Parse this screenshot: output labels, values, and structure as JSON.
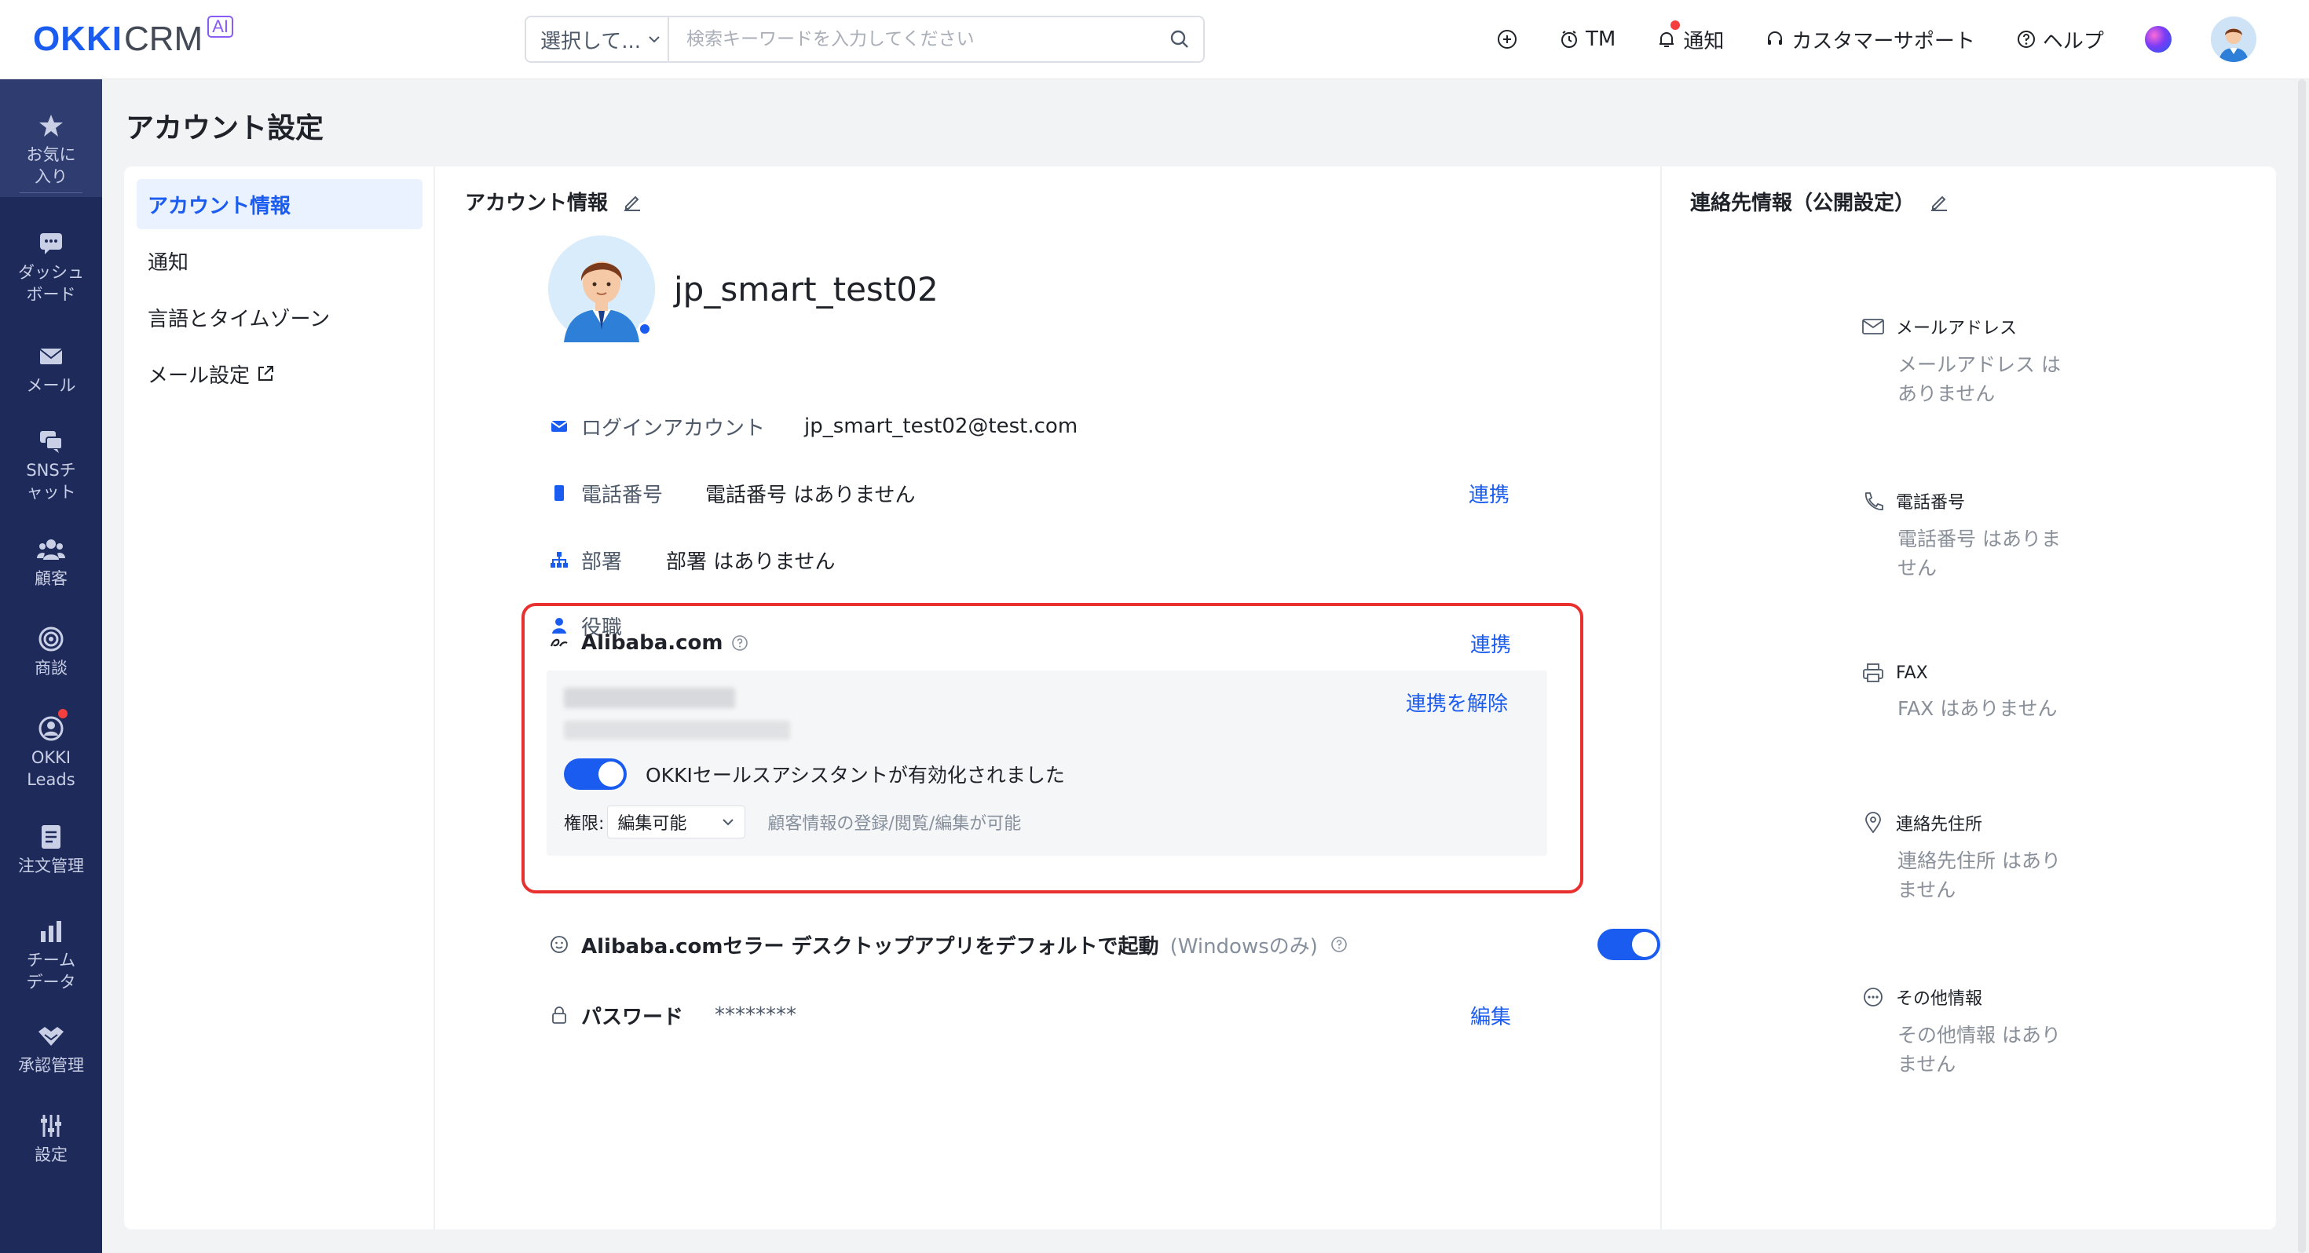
{
  "brand": {
    "okki": "OKKI",
    "crm": "CRM",
    "ai": "AI"
  },
  "search": {
    "select_label": "選択して...",
    "placeholder": "検索キーワードを入力してください"
  },
  "header": {
    "tm": "TM",
    "notify": "通知",
    "support": "カスタマーサポート",
    "help": "ヘルプ"
  },
  "sidebar": {
    "items": [
      {
        "label": "お気に入り",
        "icon": "star-icon"
      },
      {
        "label": "ダッシュボード",
        "icon": "chat-bubble-icon"
      },
      {
        "label": "メール",
        "icon": "envelope-icon"
      },
      {
        "label": "SNSチャット",
        "icon": "sns-chat-icon"
      },
      {
        "label": "顧客",
        "icon": "customers-icon"
      },
      {
        "label": "商談",
        "icon": "target-icon"
      },
      {
        "label": "OKKI Leads",
        "icon": "leads-icon"
      },
      {
        "label": "注文管理",
        "icon": "document-icon"
      },
      {
        "label": "チームデータ",
        "icon": "bar-chart-icon"
      },
      {
        "label": "承認管理",
        "icon": "handshake-icon"
      },
      {
        "label": "設定",
        "icon": "sliders-icon"
      }
    ]
  },
  "page": {
    "title": "アカウント設定"
  },
  "nav": {
    "account_info": "アカウント情報",
    "notify": "通知",
    "lang_tz": "言語とタイムゾーン",
    "mail_settings": "メール設定"
  },
  "account": {
    "section_title": "アカウント情報",
    "username": "jp_smart_test02",
    "login_label": "ログインアカウント",
    "login_value": "jp_smart_test02@test.com",
    "phone_label": "電話番号",
    "phone_value": "電話番号 はありません",
    "phone_link": "連携",
    "dept_label": "部署",
    "dept_value": "部署 はありません",
    "role_label": "役職"
  },
  "alibaba": {
    "title": "Alibaba.com",
    "link": "連携",
    "unlink": "連携を解除",
    "assistant_text": "OKKIセールスアシスタントが有効化されました",
    "assistant_enabled": true,
    "perm_label": "権限:",
    "perm_value": "編集可能",
    "perm_desc": "顧客情報の登録/閲覧/編集が可能"
  },
  "desktop_app": {
    "label": "Alibaba.comセラー デスクトップアプリをデフォルトで起動",
    "note": "(Windowsのみ)",
    "enabled": true
  },
  "password": {
    "label": "パスワード",
    "value": "********",
    "edit": "編集"
  },
  "contact": {
    "section_title": "連絡先情報（公開設定）",
    "email_label": "メールアドレス",
    "email_value": "メールアドレス はありません",
    "phone_label": "電話番号",
    "phone_value": "電話番号 はありません",
    "fax_label": "FAX",
    "fax_value": "FAX はありません",
    "address_label": "連絡先住所",
    "address_value": "連絡先住所 はありません",
    "other_label": "その他情報",
    "other_value": "その他情報 はありません"
  },
  "colors": {
    "brand_blue": "#1b5cf0",
    "sidebar_bg": "#1e2a5a",
    "highlight_red": "#e8312f"
  }
}
